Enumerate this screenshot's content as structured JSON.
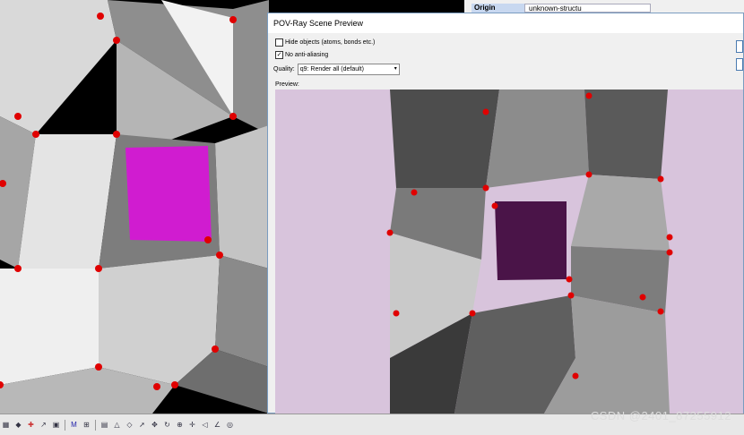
{
  "properties": {
    "origin_key": "Origin",
    "origin_value": "unknown-structu"
  },
  "dialog": {
    "title": "POV-Ray Scene Preview",
    "hide_objects_label": "Hide objects (atoms, bonds etc.)",
    "hide_objects_checked": false,
    "no_antialiasing_label": "No anti-aliasing",
    "no_antialiasing_checked": true,
    "quality_label": "Quality:",
    "quality_value": "q9: Render all (default)",
    "preview_label": "Preview:"
  },
  "colors": {
    "preview_bg": "#d8c4dc",
    "void_left": "#d01cd0",
    "void_preview": "#4a1448",
    "atom": "#e00000"
  },
  "watermark": "CSDN @2401_87255912",
  "toolbar_icons": [
    "layer-icon",
    "select-icon",
    "palette-icon",
    "arrow-icon",
    "cube-icon",
    "molecule-icon",
    "grid-icon",
    "chart-icon",
    "triangle-icon",
    "eraser-icon",
    "cursor-icon",
    "move-icon",
    "rotate-icon",
    "zoom-icon",
    "center-icon",
    "tag-icon",
    "measure-icon",
    "view-icon"
  ]
}
